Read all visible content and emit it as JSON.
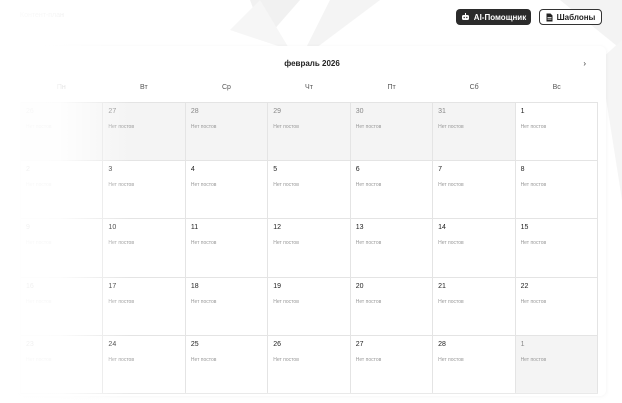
{
  "topbar": {
    "breadcrumb": "Контент-план",
    "ai_button": "AI-Помощник",
    "templates_button": "Шаблоны"
  },
  "calendar": {
    "month_title": "февраль 2026",
    "next_icon": "chevron-right-icon",
    "weekdays": [
      "Пн",
      "Вт",
      "Ср",
      "Чт",
      "Пт",
      "Сб",
      "Вс"
    ],
    "empty_label": "Нет постов",
    "weeks": [
      [
        {
          "day": "26",
          "other": true
        },
        {
          "day": "27",
          "other": true
        },
        {
          "day": "28",
          "other": true
        },
        {
          "day": "29",
          "other": true
        },
        {
          "day": "30",
          "other": true
        },
        {
          "day": "31",
          "other": true
        },
        {
          "day": "1",
          "other": false
        }
      ],
      [
        {
          "day": "2",
          "other": false
        },
        {
          "day": "3",
          "other": false
        },
        {
          "day": "4",
          "other": false
        },
        {
          "day": "5",
          "other": false
        },
        {
          "day": "6",
          "other": false
        },
        {
          "day": "7",
          "other": false
        },
        {
          "day": "8",
          "other": false
        }
      ],
      [
        {
          "day": "9",
          "other": false
        },
        {
          "day": "10",
          "other": false
        },
        {
          "day": "11",
          "other": false
        },
        {
          "day": "12",
          "other": false
        },
        {
          "day": "13",
          "other": false
        },
        {
          "day": "14",
          "other": false
        },
        {
          "day": "15",
          "other": false
        }
      ],
      [
        {
          "day": "16",
          "other": false
        },
        {
          "day": "17",
          "other": false
        },
        {
          "day": "18",
          "other": false
        },
        {
          "day": "19",
          "other": false
        },
        {
          "day": "20",
          "other": false
        },
        {
          "day": "21",
          "other": false
        },
        {
          "day": "22",
          "other": false
        }
      ],
      [
        {
          "day": "23",
          "other": false
        },
        {
          "day": "24",
          "other": false
        },
        {
          "day": "25",
          "other": false
        },
        {
          "day": "26",
          "other": false
        },
        {
          "day": "27",
          "other": false
        },
        {
          "day": "28",
          "other": false
        },
        {
          "day": "1",
          "other": true
        }
      ]
    ]
  },
  "colors": {
    "dark_button": "#2b2b2b",
    "other_month_bg": "#f4f4f4",
    "grid_line": "#e4e4e4"
  }
}
